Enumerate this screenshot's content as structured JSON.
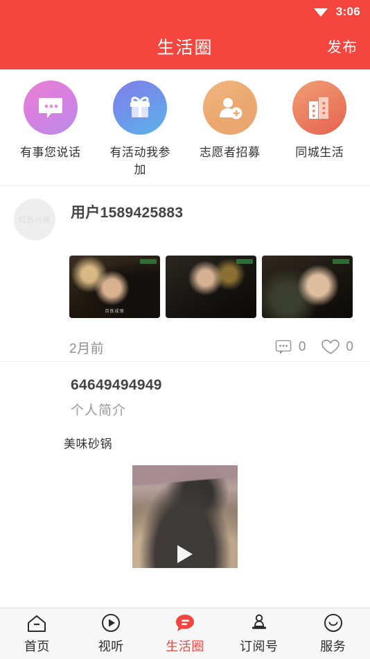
{
  "status_bar": {
    "time": "3:06",
    "wifi_icon": "wifi-icon"
  },
  "header": {
    "title": "生活圈",
    "action_label": "发布",
    "background": "#f4463f"
  },
  "categories": [
    {
      "label": "有事您说话",
      "icon": "chat-bubble-icon",
      "gradient_from": "#e97fd0",
      "gradient_to": "#b98ce8"
    },
    {
      "label": "有活动我参加",
      "icon": "gift-icon",
      "gradient_from": "#7f7fe8",
      "gradient_to": "#59b6e8"
    },
    {
      "label": "志愿者招募",
      "icon": "add-person-icon",
      "gradient_from": "#f0b882",
      "gradient_to": "#e8a471"
    },
    {
      "label": "同城生活",
      "icon": "buildings-icon",
      "gradient_from": "#f0a074",
      "gradient_to": "#e4604f"
    }
  ],
  "posts": [
    {
      "username": "用户1589425883",
      "avatar_placeholder": "红色兴县",
      "time": "2月前",
      "comment_icon": "comment-bubble-icon",
      "comment_count": "0",
      "like_icon": "heart-icon",
      "like_count": "0",
      "thumbnails": [
        {
          "name": "post-thumbnail-1",
          "caption": "百炼成钢",
          "watermark": "watermark"
        },
        {
          "name": "post-thumbnail-2",
          "caption": "",
          "watermark": "watermark"
        },
        {
          "name": "post-thumbnail-3",
          "caption": "",
          "watermark": "watermark"
        }
      ]
    },
    {
      "username": "64649494949",
      "subtitle": "个人简介",
      "text": "美味砂锅",
      "video": {
        "name": "post-video-thumbnail",
        "play_icon": "play-icon"
      }
    }
  ],
  "tabbar": {
    "active_color": "#f4463f",
    "items": [
      {
        "label": "首页",
        "icon": "home-icon",
        "active": false
      },
      {
        "label": "视听",
        "icon": "play-circle-icon",
        "active": false
      },
      {
        "label": "生活圈",
        "icon": "life-circle-icon",
        "active": true
      },
      {
        "label": "订阅号",
        "icon": "subscription-stamp-icon",
        "active": false
      },
      {
        "label": "服务",
        "icon": "smiley-service-icon",
        "active": false
      }
    ]
  }
}
